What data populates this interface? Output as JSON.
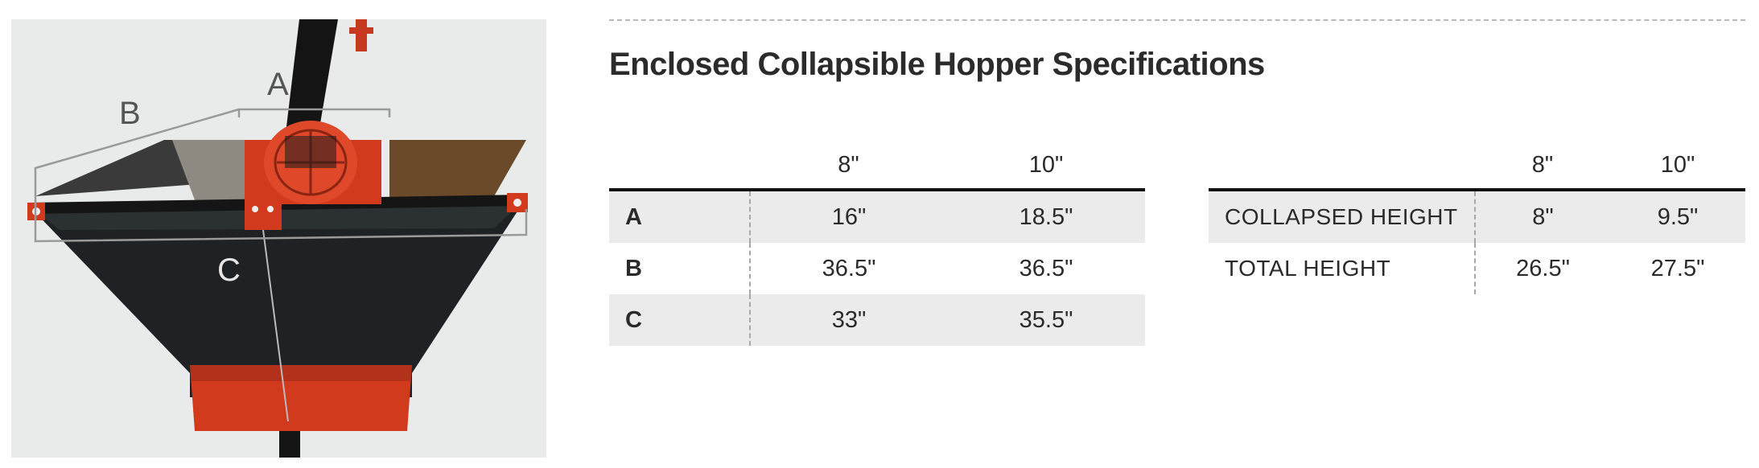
{
  "title": "Enclosed Collapsible Hopper Specifications",
  "photo": {
    "description_icon": "hopper-photo",
    "labels": {
      "a": "A",
      "b": "B",
      "c": "C"
    }
  },
  "dimensions_table": {
    "headers": [
      "",
      "8\"",
      "10\""
    ],
    "rows": [
      {
        "label": "A",
        "v8": "16\"",
        "v10": "18.5\""
      },
      {
        "label": "B",
        "v8": "36.5\"",
        "v10": "36.5\""
      },
      {
        "label": "C",
        "v8": "33\"",
        "v10": "35.5\""
      }
    ]
  },
  "height_table": {
    "headers": [
      "",
      "8\"",
      "10\""
    ],
    "rows": [
      {
        "label": "COLLAPSED HEIGHT",
        "v8": "8\"",
        "v10": "9.5\""
      },
      {
        "label": "TOTAL HEIGHT",
        "v8": "26.5\"",
        "v10": "27.5\""
      }
    ]
  },
  "colors": {
    "frame_red": "#d23a1e",
    "bag_black": "#1e2224",
    "photo_bg": "#e9eaea",
    "row_shade": "#ebebeb"
  }
}
